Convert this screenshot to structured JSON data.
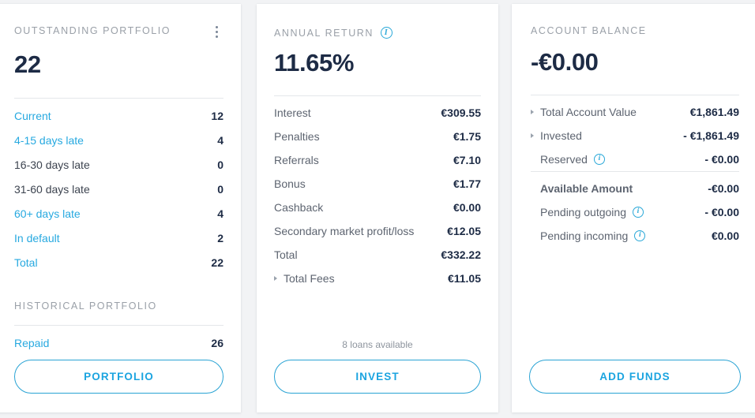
{
  "cards": {
    "outstanding": {
      "title": "OUTSTANDING PORTFOLIO",
      "menu_icon": "kebab-menu-icon",
      "value": "22",
      "rows": [
        {
          "label": "Current",
          "value": "12",
          "link": true
        },
        {
          "label": "4-15 days late",
          "value": "4",
          "link": true
        },
        {
          "label": "16-30 days late",
          "value": "0",
          "link": false
        },
        {
          "label": "31-60 days late",
          "value": "0",
          "link": false
        },
        {
          "label": "60+ days late",
          "value": "4",
          "link": true
        },
        {
          "label": "In default",
          "value": "2",
          "link": true
        },
        {
          "label": "Total",
          "value": "22",
          "link": true
        }
      ],
      "historical_title": "HISTORICAL PORTFOLIO",
      "historical_rows": [
        {
          "label": "Repaid",
          "value": "26",
          "link": true
        }
      ],
      "button_label": "PORTFOLIO"
    },
    "annual_return": {
      "title": "ANNUAL RETURN",
      "info_icon": "info-icon",
      "value": "11.65%",
      "rows": [
        {
          "label": "Interest",
          "value": "€309.55",
          "arrow": false
        },
        {
          "label": "Penalties",
          "value": "€1.75",
          "arrow": false
        },
        {
          "label": "Referrals",
          "value": "€7.10",
          "arrow": false
        },
        {
          "label": "Bonus",
          "value": "€1.77",
          "arrow": false
        },
        {
          "label": "Cashback",
          "value": "€0.00",
          "arrow": false
        },
        {
          "label": "Secondary market profit/loss",
          "value": "€12.05",
          "arrow": false
        },
        {
          "label": "Total",
          "value": "€332.22",
          "arrow": false
        },
        {
          "label": "Total Fees",
          "value": "€11.05",
          "arrow": true
        }
      ],
      "loans_note": "8 loans available",
      "button_label": "INVEST"
    },
    "account_balance": {
      "title": "ACCOUNT BALANCE",
      "value": "-€0.00",
      "rows_top": [
        {
          "label": "Total Account Value",
          "value": "€1,861.49",
          "arrow": true,
          "info": false
        },
        {
          "label": "Invested",
          "value": "- €1,861.49",
          "arrow": true,
          "info": false
        },
        {
          "label": "Reserved",
          "value": "- €0.00",
          "arrow": false,
          "info": true
        }
      ],
      "rows_bottom": [
        {
          "label": "Available Amount",
          "value": "-€0.00",
          "arrow": false,
          "info": false,
          "strong": true
        },
        {
          "label": "Pending outgoing",
          "value": "- €0.00",
          "arrow": false,
          "info": true,
          "strong": false
        },
        {
          "label": "Pending incoming",
          "value": "€0.00",
          "arrow": false,
          "info": true,
          "strong": false
        }
      ],
      "button_label": "ADD FUNDS"
    }
  },
  "colors": {
    "accent": "#27a9e0",
    "value_dark": "#1d2b45",
    "label_gray": "#5d6470",
    "header_gray": "#9aa0a8",
    "page_bg": "#f2f3f5",
    "card_bg": "#ffffff"
  }
}
